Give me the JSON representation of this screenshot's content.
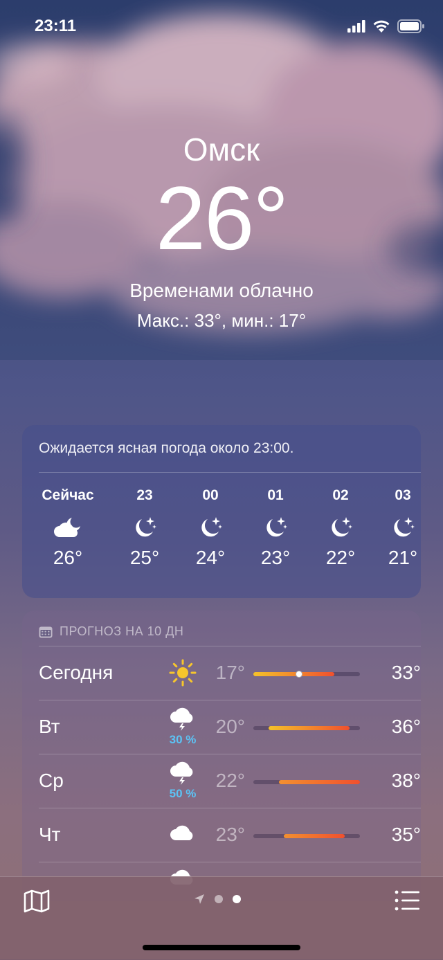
{
  "status": {
    "time": "23:11",
    "signal_icon": "cellular-signal-icon",
    "wifi_icon": "wifi-icon",
    "battery_icon": "battery-icon"
  },
  "current": {
    "city": "Омск",
    "temperature": "26°",
    "condition": "Временами облачно",
    "hilo": "Макс.: 33°, мин.: 17°"
  },
  "hourly": {
    "note": "Ожидается ясная погода около 23:00.",
    "items": [
      {
        "label": "Сейчас",
        "icon": "partly-cloudy-night-icon",
        "temp": "26°"
      },
      {
        "label": "23",
        "icon": "moon-stars-icon",
        "temp": "25°"
      },
      {
        "label": "00",
        "icon": "moon-stars-icon",
        "temp": "24°"
      },
      {
        "label": "01",
        "icon": "moon-stars-icon",
        "temp": "23°"
      },
      {
        "label": "02",
        "icon": "moon-stars-icon",
        "temp": "22°"
      },
      {
        "label": "03",
        "icon": "moon-stars-icon",
        "temp": "21°"
      }
    ]
  },
  "daily": {
    "header": "ПРОГНОЗ НА 10 ДН",
    "header_icon": "calendar-icon",
    "days": [
      {
        "name": "Сегодня",
        "icon": "sun-icon",
        "precip": "",
        "low": "17°",
        "high": "33°",
        "current_temp": 26
      },
      {
        "name": "Вт",
        "icon": "thunderstorm-icon",
        "precip": "30 %",
        "low": "20°",
        "high": "36°"
      },
      {
        "name": "Ср",
        "icon": "thunderstorm-icon",
        "precip": "50 %",
        "low": "22°",
        "high": "38°"
      },
      {
        "name": "Чт",
        "icon": "cloud-icon",
        "precip": "",
        "low": "23°",
        "high": "35°"
      }
    ],
    "range_min": 17,
    "range_max": 38
  },
  "toolbar": {
    "map_icon": "map-icon",
    "location_icon": "location-arrow-icon",
    "list_icon": "list-icon"
  },
  "colors": {
    "precip": "#5cc3f5",
    "bar_start": "#f5c22a",
    "bar_end": "#f0502e"
  }
}
